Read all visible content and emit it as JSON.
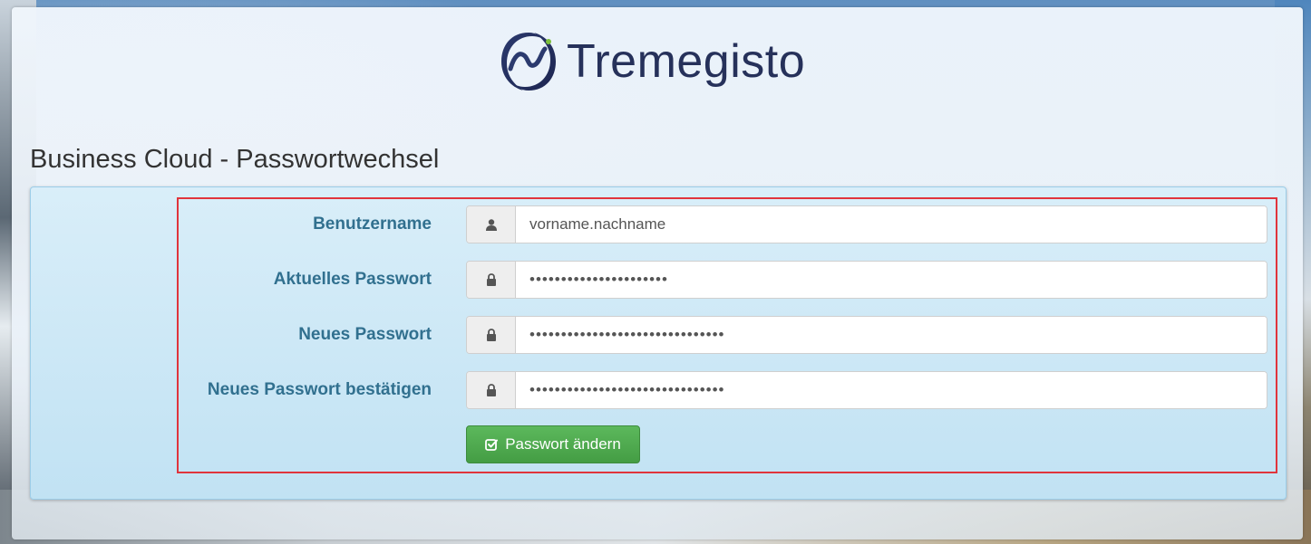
{
  "brand": {
    "name": "Tremegisto"
  },
  "page": {
    "title": "Business Cloud - Passwortwechsel"
  },
  "form": {
    "fields": [
      {
        "label": "Benutzername",
        "icon": "user-icon",
        "type": "text",
        "value": "vorname.nachname"
      },
      {
        "label": "Aktuelles Passwort",
        "icon": "lock-icon",
        "type": "password",
        "value": "••••••••••••••••••••••"
      },
      {
        "label": "Neues Passwort",
        "icon": "lock-icon",
        "type": "password",
        "value": "•••••••••••••••••••••••••••••••"
      },
      {
        "label": "Neues Passwort bestätigen",
        "icon": "lock-icon",
        "type": "password",
        "value": "•••••••••••••••••••••••••••••••"
      }
    ],
    "submit_label": "Passwort ändern",
    "submit_icon": "check-square-icon"
  },
  "colors": {
    "label": "#31708f",
    "panel_bg": "#c9e6f5",
    "button": "#5cb85c",
    "highlight": "#e0343c",
    "brand_text": "#26315a"
  }
}
